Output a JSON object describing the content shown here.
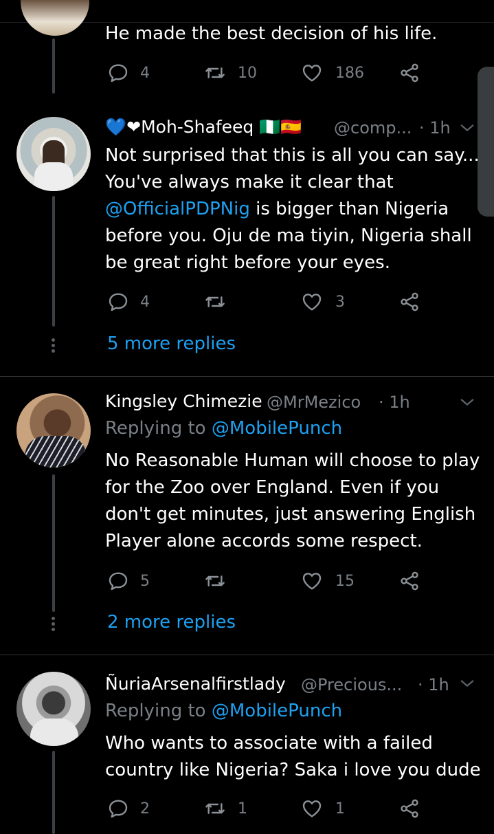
{
  "top_tweet": {
    "text": "He made the best decision of his life.",
    "replies": "4",
    "retweets": "10",
    "likes": "186"
  },
  "tweet1": {
    "name": "💙❤Moh-Shafeeq 🇳🇬🇪🇸",
    "handle": "@comp...",
    "time": "· 1h",
    "text_a": "Not surprised that this is all you can say... You've always make it clear that ",
    "mention": "@OfficialPDPNig",
    "text_b": " is bigger than Nigeria before you. Oju de ma tiyin, Nigeria shall be great right before your eyes.",
    "replies": "4",
    "retweets": "",
    "likes": "3",
    "more_replies": "5 more replies"
  },
  "tweet2": {
    "name": "Kingsley Chimezie",
    "handle": "@MrMezico",
    "time": "· 1h",
    "replying_prefix": "Replying to ",
    "replying_to": "@MobilePunch",
    "text": "No Reasonable Human will choose to play for the Zoo over England. Even if you don't get minutes, just answering English Player alone accords some respect.",
    "replies": "5",
    "retweets": "",
    "likes": "15",
    "more_replies": "2 more replies"
  },
  "tweet3": {
    "name": "ÑuriaArsenalfirstlady",
    "handle": "@Precious...",
    "time": "· 1h",
    "replying_prefix": "Replying to ",
    "replying_to": "@MobilePunch",
    "text": "Who wants to associate with a failed country like Nigeria? Saka i love you dude",
    "replies": "2",
    "retweets": "1",
    "likes": "1"
  },
  "colors": {
    "background": "#000000",
    "link": "#1da1f2",
    "muted": "#7a8086"
  },
  "icons": [
    "reply-icon",
    "retweet-icon",
    "like-icon",
    "share-icon",
    "chevron-down-icon"
  ]
}
